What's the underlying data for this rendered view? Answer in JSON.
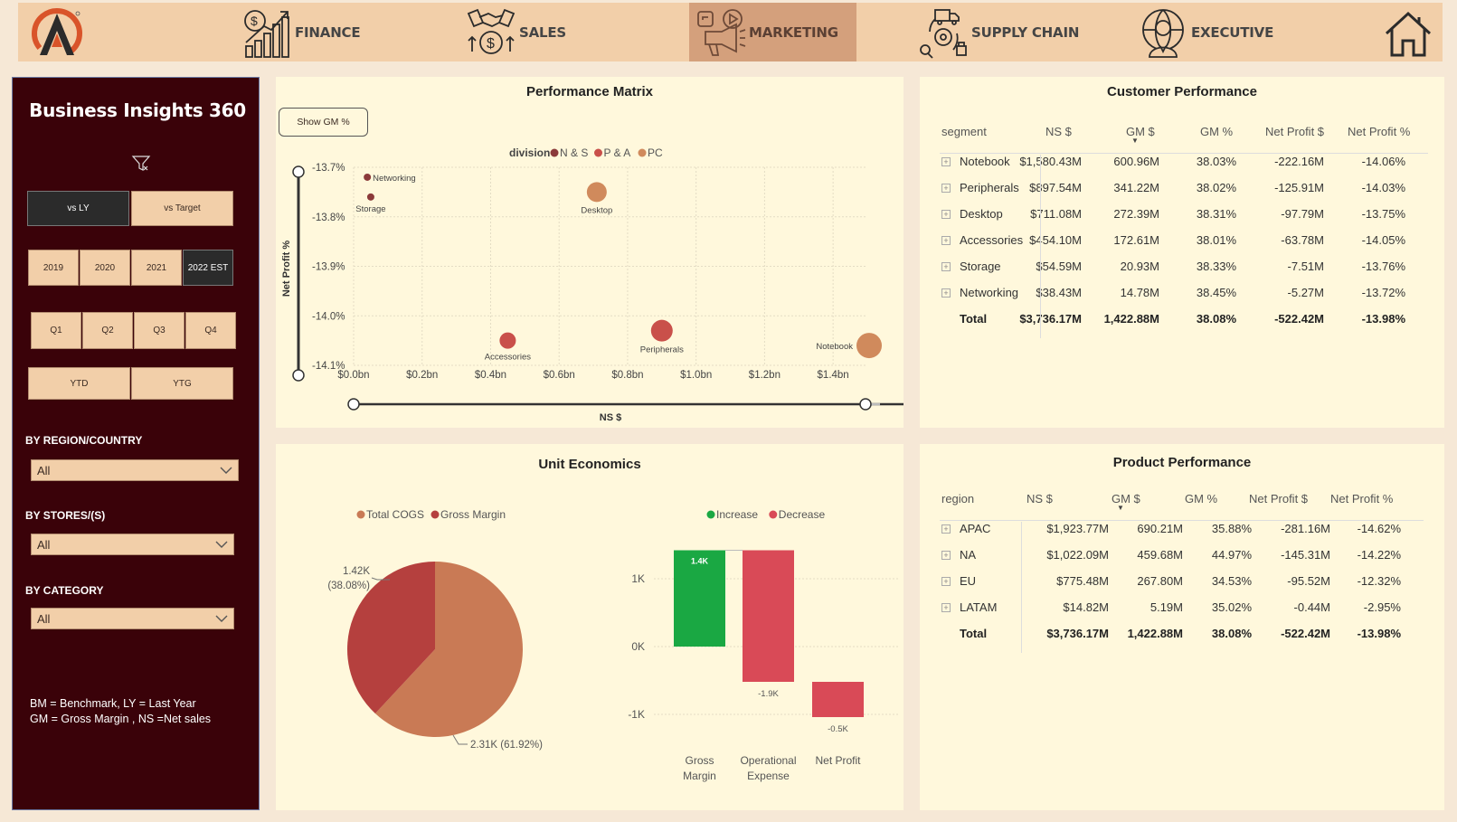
{
  "nav": {
    "items": [
      {
        "label": "FINANCE",
        "icon": "finance-icon"
      },
      {
        "label": "SALES",
        "icon": "sales-icon"
      },
      {
        "label": "MARKETING",
        "icon": "marketing-icon",
        "active": true
      },
      {
        "label": "SUPPLY CHAIN",
        "icon": "supply-chain-icon"
      },
      {
        "label": "EXECUTIVE",
        "icon": "executive-icon"
      }
    ]
  },
  "sidebar": {
    "title": "Business Insights 360",
    "compare": {
      "vs_ly": "vs LY",
      "vs_target": "vs Target"
    },
    "years": [
      "2019",
      "2020",
      "2021",
      "2022 EST"
    ],
    "quarters": [
      "Q1",
      "Q2",
      "Q3",
      "Q4"
    ],
    "periods": {
      "ytd": "YTD",
      "ytg": "YTG"
    },
    "filters": {
      "region_label": "BY REGION/COUNTRY",
      "region_value": "All",
      "stores_label": "BY STORES/(S)",
      "stores_value": "All",
      "category_label": "BY CATEGORY",
      "category_value": "All"
    },
    "note_line1": "BM = Benchmark, LY = Last Year",
    "note_line2": "GM = Gross Margin , NS =Net sales"
  },
  "performance_matrix": {
    "title": "Performance Matrix",
    "toggle_label": "Show GM %",
    "legend_title": "division",
    "legend": [
      {
        "name": "N & S",
        "color": "#8b3a3a"
      },
      {
        "name": "P & A",
        "color": "#c9504a"
      },
      {
        "name": "PC",
        "color": "#d08a5c"
      }
    ],
    "xlabel": "NS $",
    "ylabel": "Net Profit %"
  },
  "unit_economics": {
    "title": "Unit Economics",
    "pie_legend": [
      {
        "name": "Total COGS",
        "color": "#c97a55"
      },
      {
        "name": "Gross Margin",
        "color": "#b5403e"
      }
    ],
    "pie_label_gm": "1.42K",
    "pie_label_gm_pct": "(38.08%)",
    "pie_label_cogs": "2.31K (61.92%)",
    "wf_legend": [
      {
        "name": "Increase",
        "color": "#1aa843"
      },
      {
        "name": "Decrease",
        "color": "#d94a57"
      }
    ],
    "wf_labels": [
      "1.4K",
      "-1.9K",
      "-0.5K"
    ],
    "wf_cat1a": "Gross",
    "wf_cat1b": "Margin",
    "wf_cat2a": "Operational",
    "wf_cat2b": "Expense",
    "wf_cat3": "Net Profit"
  },
  "customer_performance": {
    "title": "Customer Performance",
    "headers": [
      "segment",
      "NS $",
      "GM $",
      "GM %",
      "Net Profit $",
      "Net Profit %"
    ],
    "rows": [
      [
        "Notebook",
        "$1,580.43M",
        "600.96M",
        "38.03%",
        "-222.16M",
        "-14.06%"
      ],
      [
        "Peripherals",
        "$897.54M",
        "341.22M",
        "38.02%",
        "-125.91M",
        "-14.03%"
      ],
      [
        "Desktop",
        "$711.08M",
        "272.39M",
        "38.31%",
        "-97.79M",
        "-13.75%"
      ],
      [
        "Accessories",
        "$454.10M",
        "172.61M",
        "38.01%",
        "-63.78M",
        "-14.05%"
      ],
      [
        "Storage",
        "$54.59M",
        "20.93M",
        "38.33%",
        "-7.51M",
        "-13.76%"
      ],
      [
        "Networking",
        "$38.43M",
        "14.78M",
        "38.45%",
        "-5.27M",
        "-13.72%"
      ]
    ],
    "total": [
      "Total",
      "$3,736.17M",
      "1,422.88M",
      "38.08%",
      "-522.42M",
      "-13.98%"
    ]
  },
  "product_performance": {
    "title": "Product Performance",
    "headers": [
      "region",
      "NS $",
      "GM $",
      "GM %",
      "Net Profit $",
      "Net Profit %"
    ],
    "rows": [
      [
        "APAC",
        "$1,923.77M",
        "690.21M",
        "35.88%",
        "-281.16M",
        "-14.62%"
      ],
      [
        "NA",
        "$1,022.09M",
        "459.68M",
        "44.97%",
        "-145.31M",
        "-14.22%"
      ],
      [
        "EU",
        "$775.48M",
        "267.80M",
        "34.53%",
        "-95.52M",
        "-12.32%"
      ],
      [
        "LATAM",
        "$14.82M",
        "5.19M",
        "35.02%",
        "-0.44M",
        "-2.95%"
      ]
    ],
    "total": [
      "Total",
      "$3,736.17M",
      "1,422.88M",
      "38.08%",
      "-522.42M",
      "-13.98%"
    ]
  },
  "chart_data": [
    {
      "type": "scatter",
      "title": "Performance Matrix",
      "xlabel": "NS $",
      "ylabel": "Net Profit %",
      "xlim": [
        0,
        1.5
      ],
      "ylim": [
        -14.1,
        -13.7
      ],
      "x_ticks": [
        "$0.0bn",
        "$0.2bn",
        "$0.4bn",
        "$0.6bn",
        "$0.8bn",
        "$1.0bn",
        "$1.2bn",
        "$1.4bn"
      ],
      "y_ticks": [
        "-13.7%",
        "-13.8%",
        "-13.9%",
        "-14.0%",
        "-14.1%"
      ],
      "points": [
        {
          "label": "Networking",
          "division": "N & S",
          "x": 0.04,
          "y": -13.72,
          "size": 4
        },
        {
          "label": "Storage",
          "division": "N & S",
          "x": 0.05,
          "y": -13.76,
          "size": 4
        },
        {
          "label": "Desktop",
          "division": "PC",
          "x": 0.71,
          "y": -13.75,
          "size": 11
        },
        {
          "label": "Accessories",
          "division": "P & A",
          "x": 0.45,
          "y": -14.05,
          "size": 9
        },
        {
          "label": "Peripherals",
          "division": "P & A",
          "x": 0.9,
          "y": -14.03,
          "size": 12
        },
        {
          "label": "Notebook",
          "division": "PC",
          "x": 1.58,
          "y": -14.06,
          "size": 14
        }
      ]
    },
    {
      "type": "pie",
      "title": "Unit Economics",
      "slices": [
        {
          "name": "Total COGS",
          "value": 2.31,
          "pct": 61.92
        },
        {
          "name": "Gross Margin",
          "value": 1.42,
          "pct": 38.08
        }
      ]
    },
    {
      "type": "bar",
      "subtype": "waterfall",
      "categories": [
        "Gross Margin",
        "Operational Expense",
        "Net Profit"
      ],
      "values": [
        1.42,
        -1.94,
        -0.52
      ],
      "y_ticks": [
        "1K",
        "0K",
        "-1K"
      ],
      "ylim": [
        -1.5,
        1.5
      ]
    }
  ]
}
